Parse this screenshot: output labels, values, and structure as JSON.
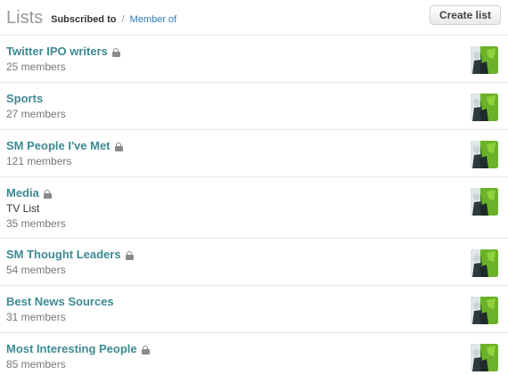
{
  "header": {
    "title": "Lists",
    "tab_subscribed": "Subscribed to",
    "tab_separator": "/",
    "tab_member_of": "Member of",
    "create_button": "Create list"
  },
  "colors": {
    "list_name": "#3d8a94",
    "link": "#2b7bb9",
    "muted": "#777777"
  },
  "lists": [
    {
      "name": "Twitter IPO writers",
      "private": true,
      "description": "",
      "members": "25 members"
    },
    {
      "name": "Sports",
      "private": false,
      "description": "",
      "members": "27 members"
    },
    {
      "name": "SM People I've Met",
      "private": true,
      "description": "",
      "members": "121 members"
    },
    {
      "name": "Media",
      "private": true,
      "description": "TV List",
      "members": "35 members"
    },
    {
      "name": "SM Thought Leaders",
      "private": true,
      "description": "",
      "members": "54 members"
    },
    {
      "name": "Best News Sources",
      "private": false,
      "description": "",
      "members": "31 members"
    },
    {
      "name": "Most Interesting People",
      "private": true,
      "description": "",
      "members": "85 members"
    }
  ],
  "icons": {
    "private": "lock-icon",
    "owner": "avatar"
  }
}
